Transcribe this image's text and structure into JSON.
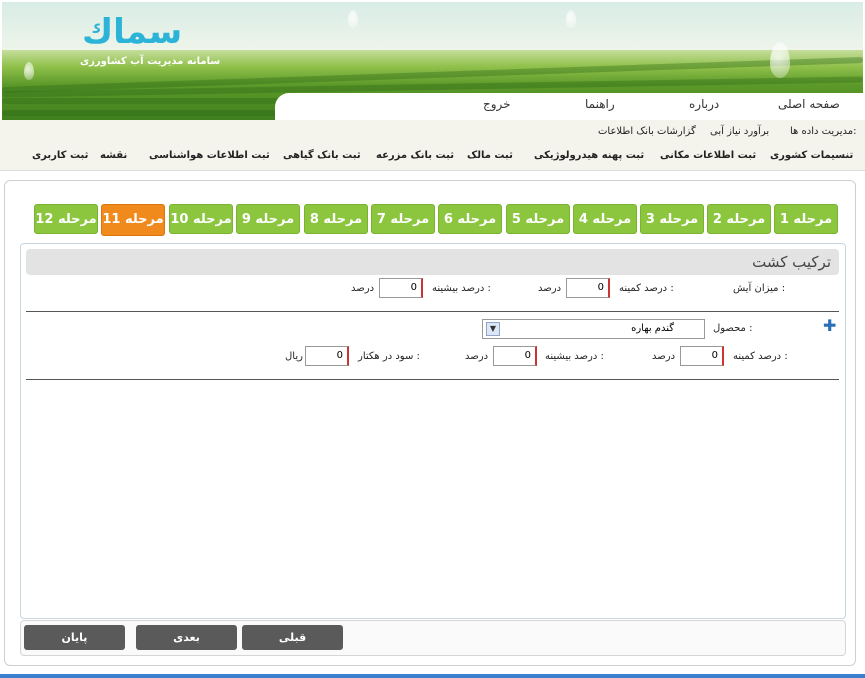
{
  "brand": {
    "logo_text": "سماك",
    "subtitle": "سامانه مدیریت آب کشاورزی"
  },
  "topnav": {
    "items": [
      "صفحه اصلی",
      "درباره",
      "راهنما",
      "خروج"
    ]
  },
  "menu1": {
    "items": [
      "مدیریت داده ها:",
      "برآورد نیاز آبی",
      "گزارشات بانک اطلاعات"
    ]
  },
  "menu2": {
    "items": [
      "تنسیمات کشوری",
      "ثبت اطلاعات مکانی",
      "ثبت پهنه هیدرولوژیکی",
      "ثبت مالک",
      "ثبت بانک مزرعه",
      "ثبت بانک گیاهی",
      "ثبت اطلاعات هواشناسی",
      "نقشه",
      "ثبت کاربری"
    ]
  },
  "steps": {
    "items": [
      "مرحله 1",
      "مرحله 2",
      "مرحله 3",
      "مرحله 4",
      "مرحله 5",
      "مرحله 6",
      "مرحله 7",
      "مرحله 8",
      "مرحله 9",
      "مرحله 10",
      "مرحله 11",
      "مرحله 12"
    ],
    "active": "مرحله 11"
  },
  "section": {
    "title": "ترکیب کشت"
  },
  "row1": {
    "mizan_label": "میزان آیش :",
    "min_label": "درصد کمینه :",
    "min_value": "0",
    "min_unit": "درصد",
    "max_label": "درصد بیشینه :",
    "max_value": "0",
    "max_unit": "درصد"
  },
  "row2": {
    "product_label": "محصول :",
    "product_value": "گندم بهاره",
    "min_label": "درصد کمینه :",
    "min_value": "0",
    "min_unit": "درصد",
    "max_label": "درصد بیشینه :",
    "max_value": "0",
    "max_unit": "درصد",
    "profit_label": "سود در هکتار :",
    "profit_value": "0",
    "profit_unit": "ریال"
  },
  "buttons": {
    "prev": "قبلی",
    "next": "بعدی",
    "finish": "پایان"
  },
  "colors": {
    "step_green": "#8cc63f",
    "step_active": "#f08a1c",
    "button_gray": "#5a5a5a"
  }
}
